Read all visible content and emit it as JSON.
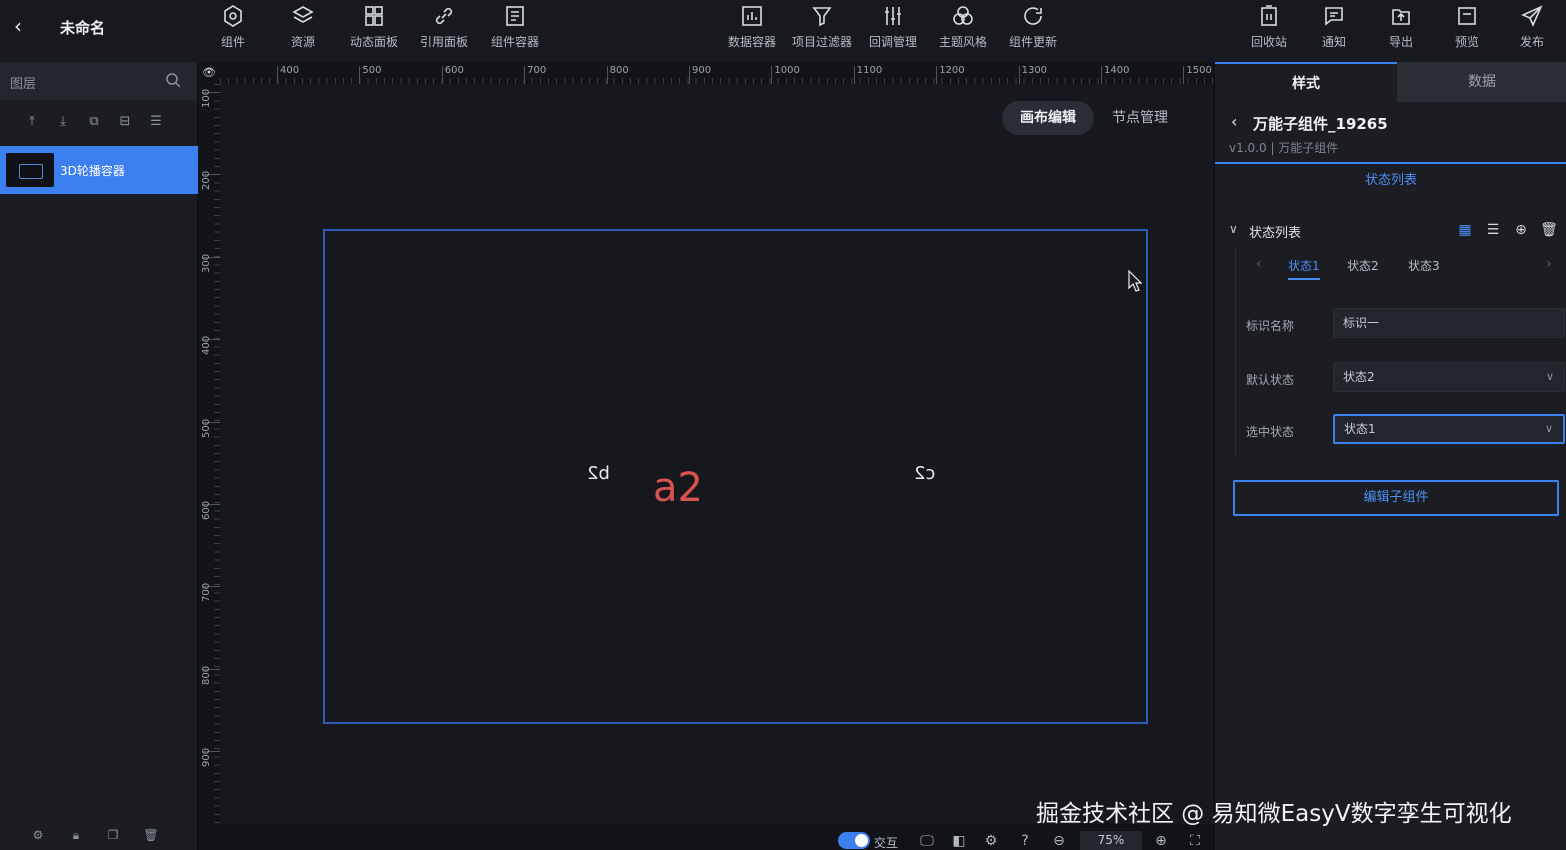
{
  "header": {
    "title": "未命名",
    "tools_left": [
      {
        "label": "组件",
        "icon": "component-icon"
      },
      {
        "label": "资源",
        "icon": "layers-icon"
      },
      {
        "label": "动态面板",
        "icon": "panel-grid-icon"
      },
      {
        "label": "引用面板",
        "icon": "link-icon"
      },
      {
        "label": "组件容器",
        "icon": "container-icon"
      }
    ],
    "tools_center": [
      {
        "label": "数据容器",
        "icon": "chart-icon"
      },
      {
        "label": "项目过滤器",
        "icon": "filter-icon"
      },
      {
        "label": "回调管理",
        "icon": "sliders-icon"
      },
      {
        "label": "主题风格",
        "icon": "palette-icon"
      },
      {
        "label": "组件更新",
        "icon": "refresh-icon"
      }
    ],
    "tools_right": [
      {
        "label": "回收站",
        "icon": "trash-bin-icon"
      },
      {
        "label": "通知",
        "icon": "message-icon"
      },
      {
        "label": "导出",
        "icon": "export-icon"
      },
      {
        "label": "预览",
        "icon": "preview-icon"
      },
      {
        "label": "发布",
        "icon": "send-icon"
      }
    ]
  },
  "layers": {
    "title": "图层",
    "items": [
      {
        "label": "3D轮播容器",
        "selected": true
      }
    ]
  },
  "ruler": {
    "top_ticks": [
      "400",
      "500",
      "600",
      "700",
      "800",
      "900",
      "1000",
      "1100",
      "1200",
      "1300",
      "1400",
      "1500"
    ],
    "left_ticks": [
      "100",
      "200",
      "300",
      "400",
      "500",
      "600",
      "700",
      "800",
      "900"
    ]
  },
  "canvas": {
    "modes": [
      "画布编辑",
      "节点管理"
    ],
    "active_mode": "画布编辑",
    "stage_items": {
      "left": "b2",
      "center": "a2",
      "right": "c2"
    }
  },
  "canvas_bar": {
    "interact_label": "交互",
    "zoom": "75%"
  },
  "right_panel": {
    "tabs": [
      "样式",
      "数据"
    ],
    "component_name": "万能子组件_19265",
    "version": "v1.0.0 | 万能子组件",
    "subtab": "状态列表",
    "section_title": "状态列表",
    "state_tabs": [
      "状态1",
      "状态2",
      "状态3"
    ],
    "fields": [
      {
        "label": "标识名称",
        "value": "标识一"
      },
      {
        "label": "默认状态",
        "value": "状态2"
      },
      {
        "label": "选中状态",
        "value": "状态1"
      }
    ],
    "edit_button": "编辑子组件"
  },
  "watermark": "掘金技术社区 @ 易知微EasyV数字孪生可视化",
  "colors": {
    "accent": "#3e7ff0",
    "highlight": "#d8524f",
    "background": "#16181e"
  }
}
